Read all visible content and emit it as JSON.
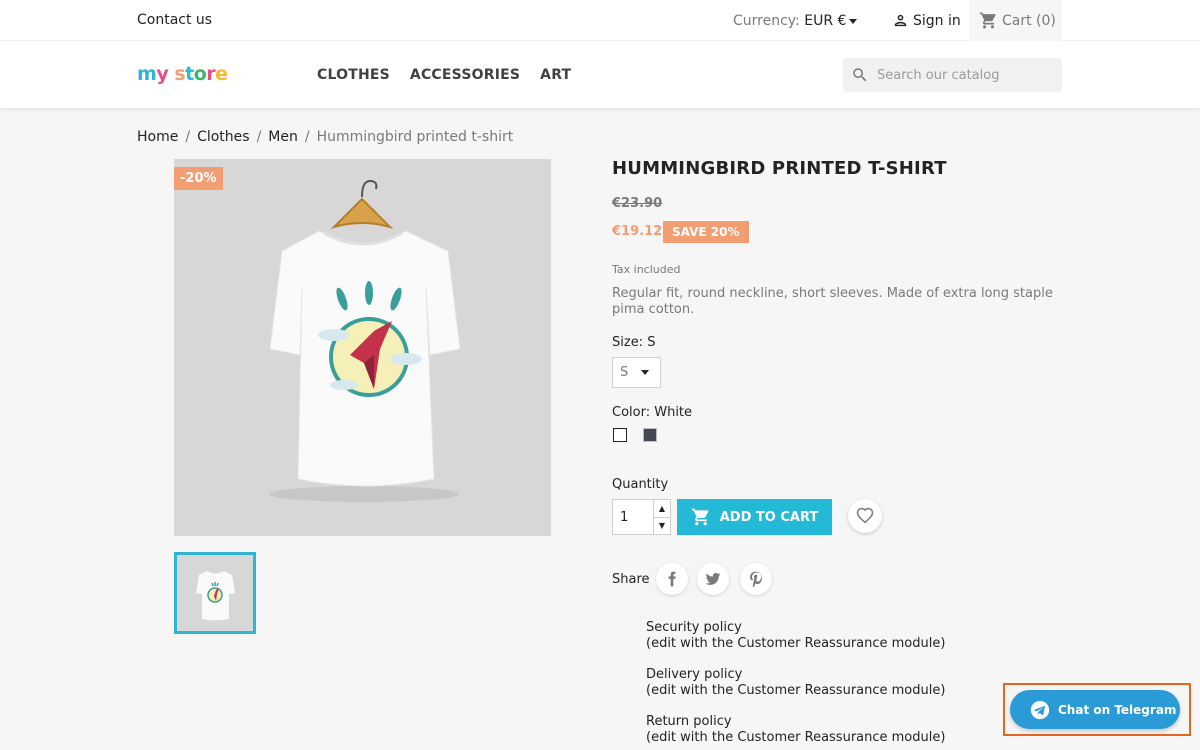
{
  "topbar": {
    "contact": "Contact us",
    "currency_label": "Currency:",
    "currency_value": "EUR €",
    "sign_in": "Sign in",
    "cart": "Cart (0)"
  },
  "header": {
    "logo": "my store",
    "nav": [
      "CLOTHES",
      "ACCESSORIES",
      "ART"
    ],
    "search_placeholder": "Search our catalog"
  },
  "breadcrumb": [
    "Home",
    "Clothes",
    "Men",
    "Hummingbird printed t-shirt"
  ],
  "product": {
    "discount_badge": "-20%",
    "title": "HUMMINGBIRD PRINTED T-SHIRT",
    "old_price": "€23.90",
    "price": "€19.12",
    "save_badge": "SAVE 20%",
    "tax": "Tax included",
    "description": "Regular fit, round neckline, short sleeves. Made of extra long staple pima cotton.",
    "size_label": "Size: S",
    "size_selected": "S",
    "color_label": "Color: White",
    "colors": [
      "#ffffff",
      "#434a54"
    ],
    "quantity_label": "Quantity",
    "quantity": "1",
    "add_to_cart": "ADD TO CART",
    "share_label": "Share"
  },
  "policies": [
    {
      "title": "Security policy",
      "note": "(edit with the Customer Reassurance module)"
    },
    {
      "title": "Delivery policy",
      "note": "(edit with the Customer Reassurance module)"
    },
    {
      "title": "Return policy",
      "note": "(edit with the Customer Reassurance module)"
    }
  ],
  "telegram": {
    "label": "Chat on Telegram"
  },
  "colors": {
    "accent": "#24b9d7",
    "discount": "#f39d72",
    "telegram": "#2a9bd7"
  }
}
